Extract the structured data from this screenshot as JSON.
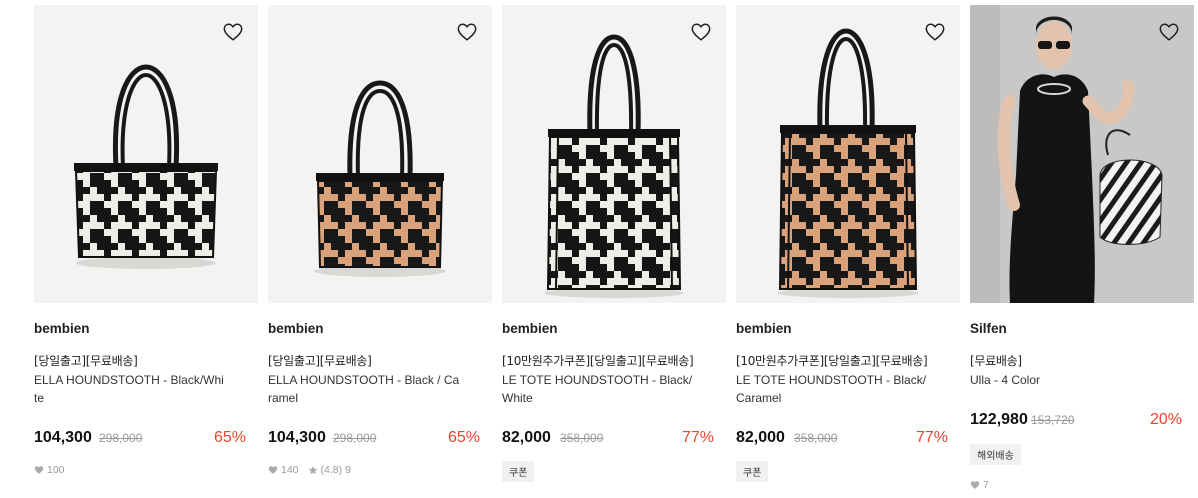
{
  "products": [
    {
      "brand": "bembien",
      "tags": "[당일출고][무료배송]",
      "name_line1": "ELLA HOUNDSTOOTH - Black/Whi",
      "name_line2": "te",
      "price": "104,300",
      "original_price": "298,000",
      "discount": "65%",
      "likes": "100",
      "rating": "",
      "reviews": "",
      "badge": ""
    },
    {
      "brand": "bembien",
      "tags": "[당일출고][무료배송]",
      "name_line1": "ELLA HOUNDSTOOTH - Black / Ca",
      "name_line2": "ramel",
      "price": "104,300",
      "original_price": "298,000",
      "discount": "65%",
      "likes": "140",
      "rating": "(4.8)",
      "reviews": "9",
      "badge": ""
    },
    {
      "brand": "bembien",
      "tags": "[10만원추가쿠폰][당일출고][무료배송]",
      "name_line1": "LE TOTE HOUNDSTOOTH - Black/",
      "name_line2": "White",
      "price": "82,000",
      "original_price": "358,000",
      "discount": "77%",
      "likes": "",
      "rating": "",
      "reviews": "",
      "badge": "쿠폰"
    },
    {
      "brand": "bembien",
      "tags": "[10만원추가쿠폰][당일출고][무료배송]",
      "name_line1": "LE TOTE HOUNDSTOOTH - Black/",
      "name_line2": "Caramel",
      "price": "82,000",
      "original_price": "358,000",
      "discount": "77%",
      "likes": "",
      "rating": "",
      "reviews": "",
      "badge": "쿠폰"
    },
    {
      "brand": "Silfen",
      "tags": "[무료배송]",
      "name_line1": "Ulla - 4 Color",
      "name_line2": "",
      "price": "122,980",
      "original_price": "153,720",
      "discount": "20%",
      "likes": "7",
      "rating": "",
      "reviews": "",
      "badge": "해외배송"
    }
  ],
  "icons": {
    "wishlist": "heart-outline-icon",
    "likes": "heart-filled-icon",
    "rating": "star-icon"
  },
  "colors": {
    "discount": "#e8452c",
    "strike": "#999999",
    "badge_bg": "#f1f1f1"
  }
}
